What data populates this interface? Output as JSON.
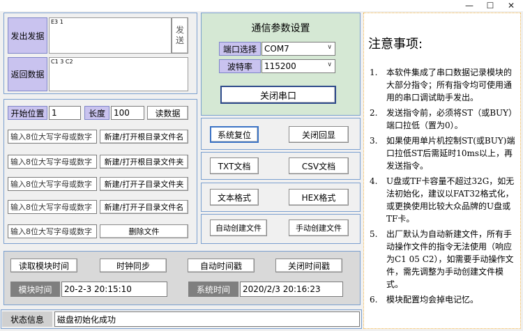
{
  "window": {
    "minimize_glyph": "—",
    "maximize_glyph": "☐",
    "close_glyph": "✕"
  },
  "send_panel": {
    "send_label": "发出发据",
    "send_value": "E3 1",
    "send_button_chars": [
      "发",
      "送"
    ],
    "return_label": "返回数据",
    "return_value": "C1 3 C2"
  },
  "file_panel": {
    "start_label": "开始位置",
    "start_value": "1",
    "length_label": "长度",
    "length_value": "100",
    "read_button": "读数据",
    "rows": [
      {
        "placeholder": "输入8位大写字母或数字",
        "button": "新建/打开根目录文件名"
      },
      {
        "placeholder": "输入8位大写字母或数字",
        "button": "新建/打开根目录文件夹"
      },
      {
        "placeholder": "输入8位大写字母或数字",
        "button": "新建/打开子目录文件夹"
      },
      {
        "placeholder": "输入8位大写字母或数字",
        "button": "新建/打开子目录文件名"
      },
      {
        "placeholder": "输入8位大写字母或数字",
        "button": "删除文件"
      }
    ]
  },
  "comm_panel": {
    "title": "通信参数设置",
    "port_label": "端口选择",
    "port_value": "COM7",
    "baud_label": "波特率",
    "baud_value": "115200",
    "close_port_button": "关闭串口"
  },
  "controls": {
    "reset_button": "系统复位",
    "echo_off_button": "关闭回显",
    "txt_button": "TXT文档",
    "csv_button": "CSV文档",
    "text_format_button": "文本格式",
    "hex_format_button": "HEX格式",
    "auto_create_button": "自动创建文件",
    "manual_create_button": "手动创建文件"
  },
  "time_panel": {
    "read_time_button": "读取模块时间",
    "sync_button": "时钟同步",
    "auto_stamp_button": "自动时间戳",
    "stamp_off_button": "关闭时间戳",
    "module_time_label": "模块时间",
    "module_time_value": "20-2-3 20:15:10",
    "system_time_label": "系统时间",
    "system_time_value": "2020/2/3 20:16:23"
  },
  "status": {
    "label": "状态信息",
    "value": "磁盘初始化成功"
  },
  "notes": {
    "title": "注意事项:",
    "items": [
      {
        "num": "1.",
        "text": "本软件集成了串口数据记录模块的大部分指令；所有指令均可使用通用的串口调试助手发出。"
      },
      {
        "num": "2.",
        "text": "发送指令前，必须将ST（或BUY）端口拉低（置为0）。"
      },
      {
        "num": "3.",
        "text": "如果使用单片机控制ST(或BUY)端口拉低ST后需延时10ms以上，再发送指令。"
      },
      {
        "num": "4.",
        "text": "U盘或TF卡容量不超过32G，如无法初始化，建议以FAT32格式化，或更换使用比较大众品牌的U盘或TF卡。"
      },
      {
        "num": "5.",
        "text": "出厂默认为自动新建文件，所有手动操作文件的指令无法使用（响应为C1 05 C2），如需要手动操作文件，需先调整为手动创建文件模式。"
      },
      {
        "num": "6.",
        "text": "模块配置均会掉电记忆。"
      }
    ]
  }
}
